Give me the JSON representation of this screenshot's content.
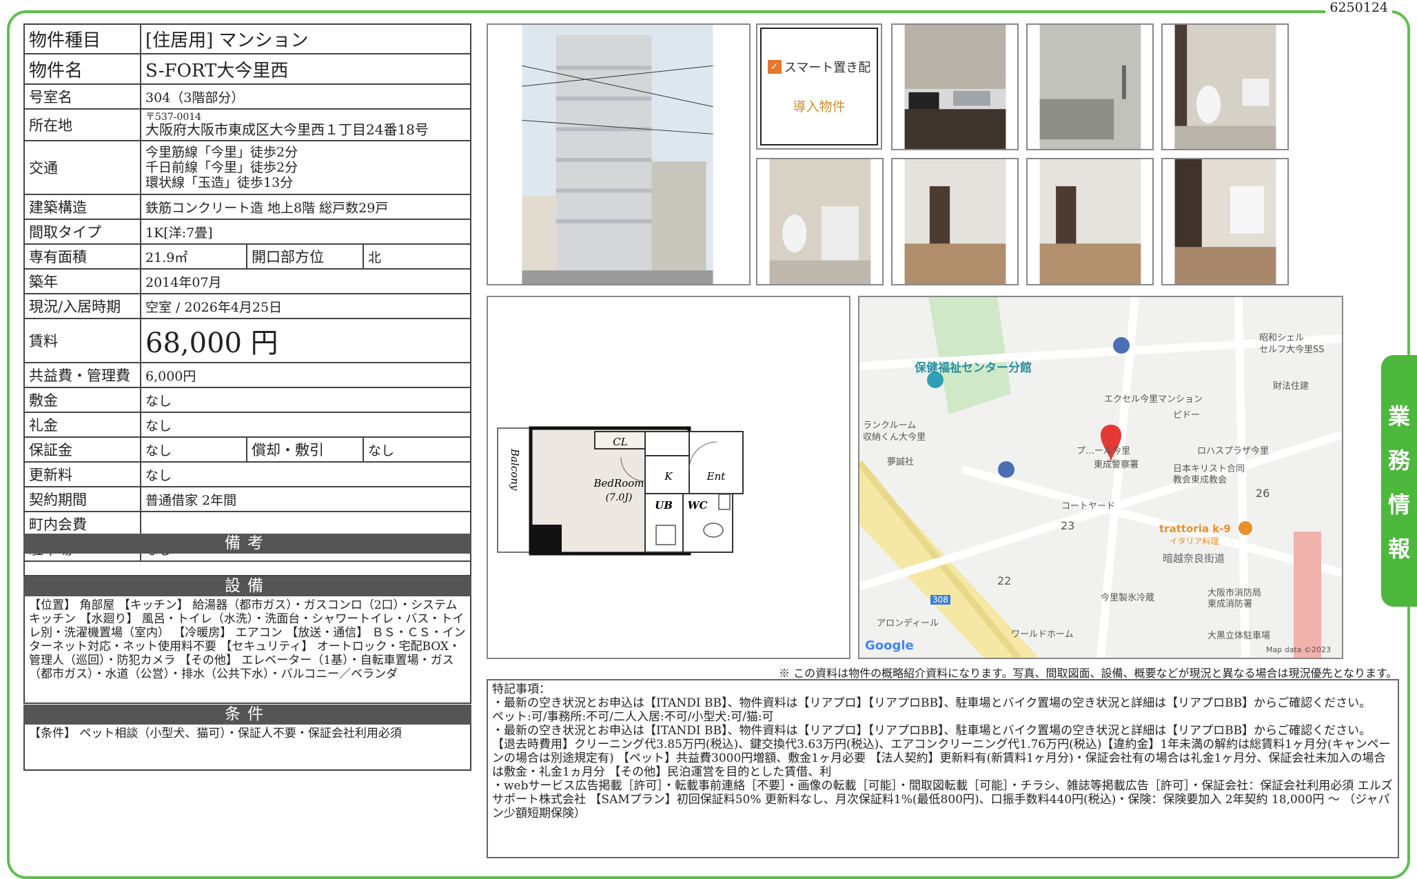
{
  "doc_id": "6250124",
  "side_tab": [
    "業",
    "務",
    "情",
    "報"
  ],
  "property": {
    "type_label": "物件種目",
    "type_value": "[住居用] マンション",
    "name_label": "物件名",
    "name_value": "S-FORT大今里西",
    "room_label": "号室名",
    "room_value": "304（3階部分）",
    "address_label": "所在地",
    "postal": "〒537-0014",
    "address": "大阪府大阪市東成区大今里西１丁目24番18号",
    "access_label": "交通",
    "access": [
      "今里筋線「今里」徒歩2分",
      "千日前線「今里」徒歩2分",
      "環状線「玉造」徒歩13分"
    ],
    "structure_label": "建築構造",
    "structure_value": "鉄筋コンクリート造 地上8階 総戸数29戸",
    "layout_label": "間取タイプ",
    "layout_value": "1K[洋:7畳]",
    "area_label": "専有面積",
    "area_value": "21.9㎡",
    "facing_label": "開口部方位",
    "facing_value": "北",
    "built_label": "築年",
    "built_value": "2014年07月",
    "status_label": "現況/入居時期",
    "status_value": "空室 / 2026年4月25日",
    "rent_label": "賃料",
    "rent_value": "68,000 円",
    "fee_label": "共益費・管理費",
    "fee_value": "6,000円",
    "deposit_label": "敷金",
    "deposit_value": "なし",
    "keymoney_label": "礼金",
    "keymoney_value": "なし",
    "guarantee_label": "保証金",
    "guarantee_value": "なし",
    "amort_label": "償却・敷引",
    "amort_value": "なし",
    "renewal_label": "更新料",
    "renewal_value": "なし",
    "contract_label": "契約期間",
    "contract_value": "普通借家 2年間",
    "community_label": "町内会費",
    "community_value": "",
    "parking_label": "駐車場",
    "parking_value": "なし"
  },
  "remarks_head": "備考",
  "remarks_body": "",
  "equipment_head": "設備",
  "equipment_body": "【位置】 角部屋 【キッチン】 給湯器（都市ガス）・ガスコンロ（2口）・システムキッチン 【水廻り】 風呂・トイレ（水洗）・洗面台・シャワートイレ・バス・トイレ別・洗濯機置場（室内） 【冷暖房】 エアコン 【放送・通信】 ＢＳ・ＣＳ・インターネット対応・ネット使用料不要 【セキュリティ】 オートロック・宅配BOX・管理人（巡回）・防犯カメラ 【その他】 エレベーター（1基）・自転車置場・ガス（都市ガス）・水道（公営）・排水（公共下水）・バルコニー／ベランダ",
  "conditions_head": "条件",
  "conditions_body": "【条件】 ペット相談（小型犬、猫可）・保証人不要・保証会社利用必須",
  "smart": {
    "line1": "スマート置き配",
    "line2": "導入物件"
  },
  "floorplan": {
    "balcony": "Balcony",
    "cl": "CL",
    "k": "K",
    "ent": "Ent",
    "bedroom": "BedRoom",
    "bedroom_size": "(7.0J)",
    "ub": "UB",
    "wc": "WC"
  },
  "map": {
    "labels": [
      "保健福祉センター分館",
      "昭和シェル",
      "セルフ大今里SS",
      "財法住建",
      "エクセル今里マンション",
      "ピドー",
      "ランクルーム",
      "収納くん大今里",
      "夢誠社",
      "プ…ール今里",
      "東成警察署",
      "ロハスプラザ今里",
      "日本キリスト合同",
      "教会東成教会",
      "コートヤード",
      "trattoria k-9",
      "イタリア料理",
      "暗越奈良街道",
      "今里製氷冷蔵",
      "大阪市消防局",
      "東成消防署",
      "アロンディール",
      "ワールドホーム",
      "大黒立体駐車場",
      "Google",
      "Map data ©2023"
    ],
    "numbers": [
      "26",
      "23",
      "22",
      "308"
    ]
  },
  "note": "※ この資料は物件の概略紹介資料になります。写真、間取図面、設備、概要などが現況と異なる場合は現況優先となります。",
  "special": {
    "heading": "特記事項：",
    "lines": [
      "・最新の空き状況とお申込は【ITANDI BB】、物件資料は【リアプロ】【リアプロBB】、駐車場とバイク置場の空き状況と詳細は【リアプロBB】からご確認ください。",
      "ペット:可/事務所:不可/二人入居:不可/小型犬:可/猫:可",
      "・最新の空き状況とお申込は【ITANDI BB】、物件資料は【リアプロ】【リアプロBB】、駐車場とバイク置場の空き状況と詳細は【リアプロBB】からご確認ください。 【退去時費用】クリーニング代3.85万円(税込)、鍵交換代3.63万円(税込)、エアコンクリーニング代1.76万円(税込)【違約金】1年未満の解約は総賃料1ヶ月分(キャンペーンの場合は別途規定有) 【ペット】共益費3000円増額、敷金1ヶ月必要 【法人契約】更新料有(新賃料1ヶ月分)・保証会社有の場合は礼金1ヶ月分、保証会社未加入の場合は敷金・礼金1ヵ月分 【その他】民泊運営を目的とした賃借、利",
      "・webサービス広告掲載［許可］・転載事前連絡［不要］・画像の転載［可能］・間取図転載［可能］・チラシ、雑誌等掲載広告［許可］・保証会社：保証会社利用必須 エルズサポート株式会社 【SAMプラン】初回保証料50% 更新料なし、月次保証料1%(最低800円)、口振手数料440円(税込)・保険：保険要加入 2年契約 18,000円 〜 （ジャパン少額短期保険）"
    ]
  }
}
